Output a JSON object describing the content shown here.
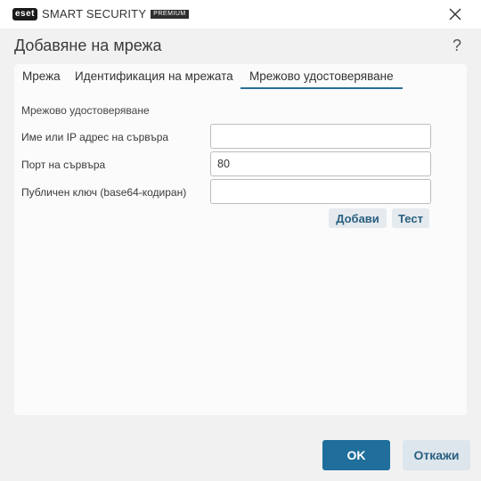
{
  "titlebar": {
    "brand_badge": "eset",
    "product": "SMART SECURITY",
    "edition": "PREMIUM",
    "close_icon": "close-icon"
  },
  "dialog": {
    "title": "Добавяне на мрежа",
    "help_label": "?"
  },
  "tabs": [
    {
      "label": "Мрежа",
      "active": false
    },
    {
      "label": "Идентификация на мрежата",
      "active": false
    },
    {
      "label": "Мрежово удостоверяване",
      "active": true
    }
  ],
  "auth": {
    "section_label": "Мрежово удостоверяване",
    "fields": [
      {
        "label": "Име или IP адрес на сървъра",
        "value": "",
        "placeholder": ""
      },
      {
        "label": "Порт на сървъра",
        "value": "80",
        "placeholder": ""
      },
      {
        "label": "Публичен ключ (base64-кодиран)",
        "value": "",
        "placeholder": ""
      }
    ],
    "add_button": "Добави",
    "test_button": "Тест"
  },
  "footer": {
    "ok_label": "OK",
    "cancel_label": "Откажи"
  },
  "colors": {
    "accent": "#1f6e9c",
    "secondary_button_bg": "#dde6ec",
    "secondary_button_text": "#2a5f80",
    "window_bg": "#f1f1f1",
    "panel_bg": "#fbfbfb"
  }
}
